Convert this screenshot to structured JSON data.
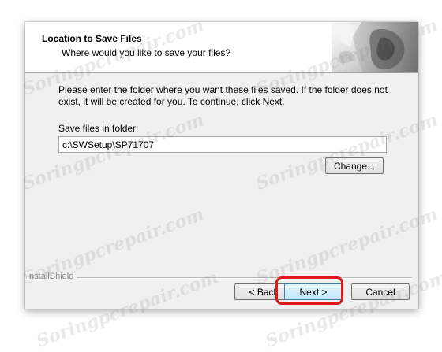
{
  "dialog": {
    "header": {
      "title": "Location to Save Files",
      "subtitle": "Where would you like to save your files?",
      "art_icon": "setup-wizard-art-icon"
    },
    "body": {
      "instructions": "Please enter the folder where you want these files saved.  If the folder does not exist, it will be created for you.   To continue, click Next.",
      "folder_label": "Save files in folder:",
      "folder_value": "c:\\SWSetup\\SP71707",
      "change_button": "Change..."
    },
    "footer": {
      "brand": "InstallShield",
      "back_button": "< Back",
      "next_button": "Next >",
      "cancel_button": "Cancel"
    }
  },
  "annotation": {
    "highlight_color": "#e01818",
    "highlighted_element": "next-button"
  },
  "watermark": {
    "text": "Soringpcrepair.com"
  }
}
